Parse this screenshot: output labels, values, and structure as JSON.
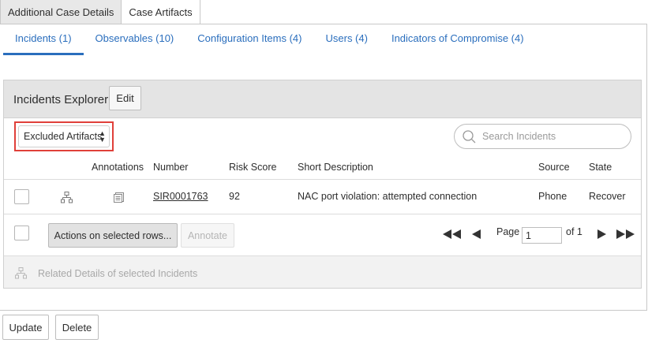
{
  "top_tabs": [
    {
      "label": "Additional Case Details",
      "active": false
    },
    {
      "label": "Case Artifacts",
      "active": true
    }
  ],
  "sub_tabs": [
    {
      "label": "Incidents (1)",
      "active": true
    },
    {
      "label": "Observables (10)",
      "active": false
    },
    {
      "label": "Configuration Items (4)",
      "active": false
    },
    {
      "label": "Users (4)",
      "active": false
    },
    {
      "label": "Indicators of Compromise (4)",
      "active": false
    }
  ],
  "explorer": {
    "title": "Incidents Explorer",
    "edit_label": "Edit",
    "filter_value": "Excluded Artifacts",
    "search_placeholder": "Search Incidents"
  },
  "table": {
    "columns": [
      "Annotations",
      "Number",
      "Risk Score",
      "Short Description",
      "Source",
      "State"
    ],
    "rows": [
      {
        "number": "SIR0001763",
        "risk_score": "92",
        "short_description": "NAC port violation: attempted connection",
        "source": "Phone",
        "state": "Recover"
      }
    ]
  },
  "footer": {
    "actions_label": "Actions on selected rows...",
    "annotate_label": "Annotate",
    "page_label": "Page",
    "page_value": "1",
    "of_label": "of 1"
  },
  "related": {
    "text": "Related Details of selected Incidents"
  },
  "bottom": {
    "update_label": "Update",
    "delete_label": "Delete"
  },
  "colors": {
    "link": "#2a6ebd",
    "highlight": "#e0403a",
    "header_bg": "#e4e4e4"
  }
}
